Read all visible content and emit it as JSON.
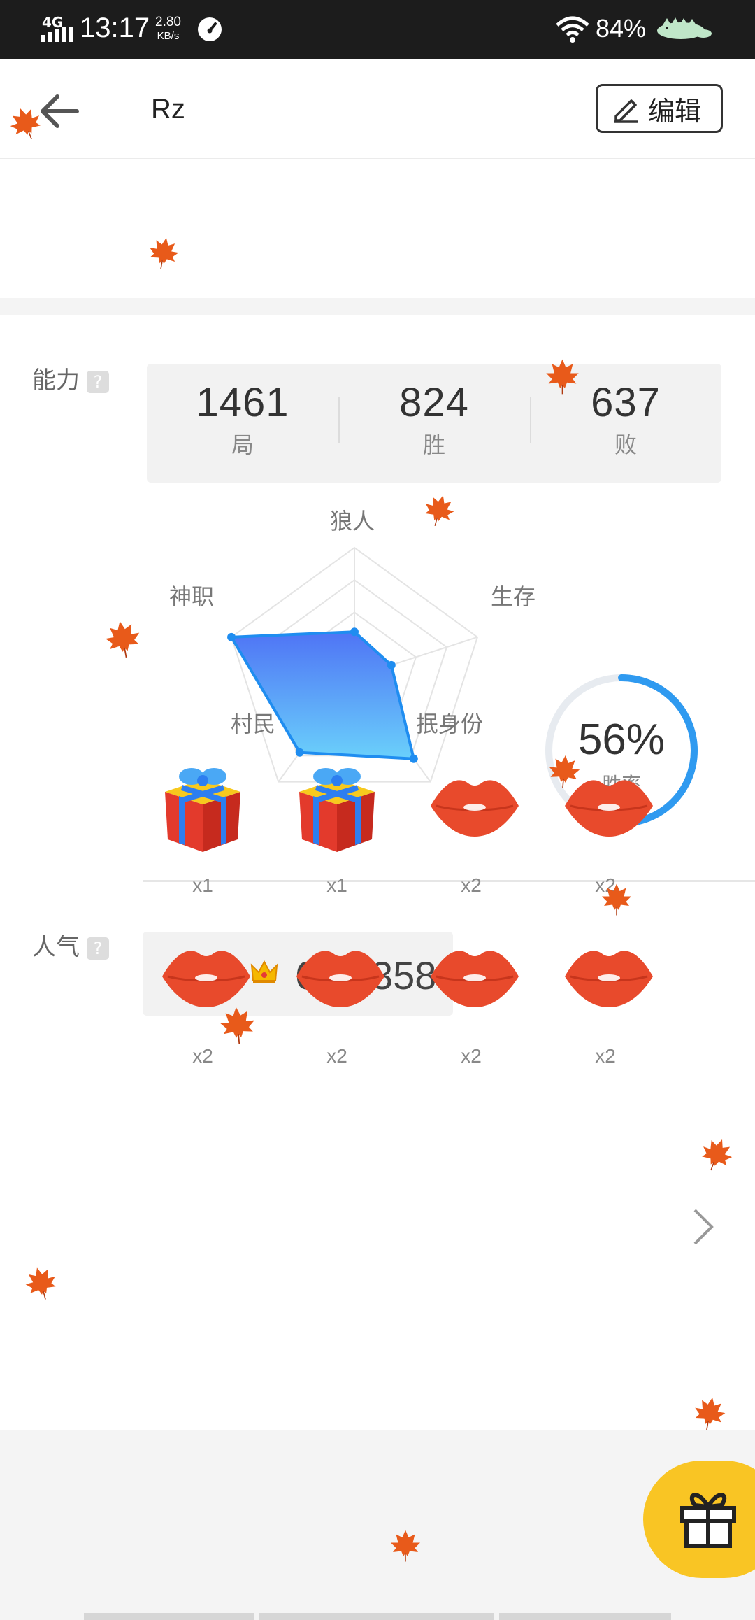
{
  "status_bar": {
    "network": "4G",
    "time": "13:17",
    "speed_value": "2.80",
    "speed_unit": "KB/s",
    "battery": "84%"
  },
  "header": {
    "title": "Rz",
    "edit_label": "编辑"
  },
  "ability": {
    "label": "能力",
    "help": "?",
    "stats": [
      {
        "value": "1461",
        "label": "局"
      },
      {
        "value": "824",
        "label": "胜"
      },
      {
        "value": "637",
        "label": "败"
      }
    ],
    "radar": {
      "axes": [
        "狼人",
        "生存",
        "抿身份",
        "村民",
        "神职"
      ],
      "values": [
        0.35,
        0.3,
        0.78,
        0.72,
        1.0
      ]
    },
    "win_rate": {
      "value": "56%",
      "label": "胜率",
      "fraction": 0.56
    }
  },
  "popularity": {
    "label": "人气",
    "help": "?",
    "value": "670,358",
    "crowns": 3
  },
  "gifts": [
    {
      "type": "gift-box",
      "count": "x1"
    },
    {
      "type": "gift-box",
      "count": "x1"
    },
    {
      "type": "lips",
      "count": "x2"
    },
    {
      "type": "lips",
      "count": "x2"
    },
    {
      "type": "lips",
      "count": "x2"
    },
    {
      "type": "lips",
      "count": "x2"
    },
    {
      "type": "lips",
      "count": "x2"
    },
    {
      "type": "lips",
      "count": "x2"
    }
  ],
  "colors": {
    "accent_blue": "#2f8fea",
    "fab_yellow": "#f9c524",
    "leaf_orange": "#e85a1a"
  }
}
